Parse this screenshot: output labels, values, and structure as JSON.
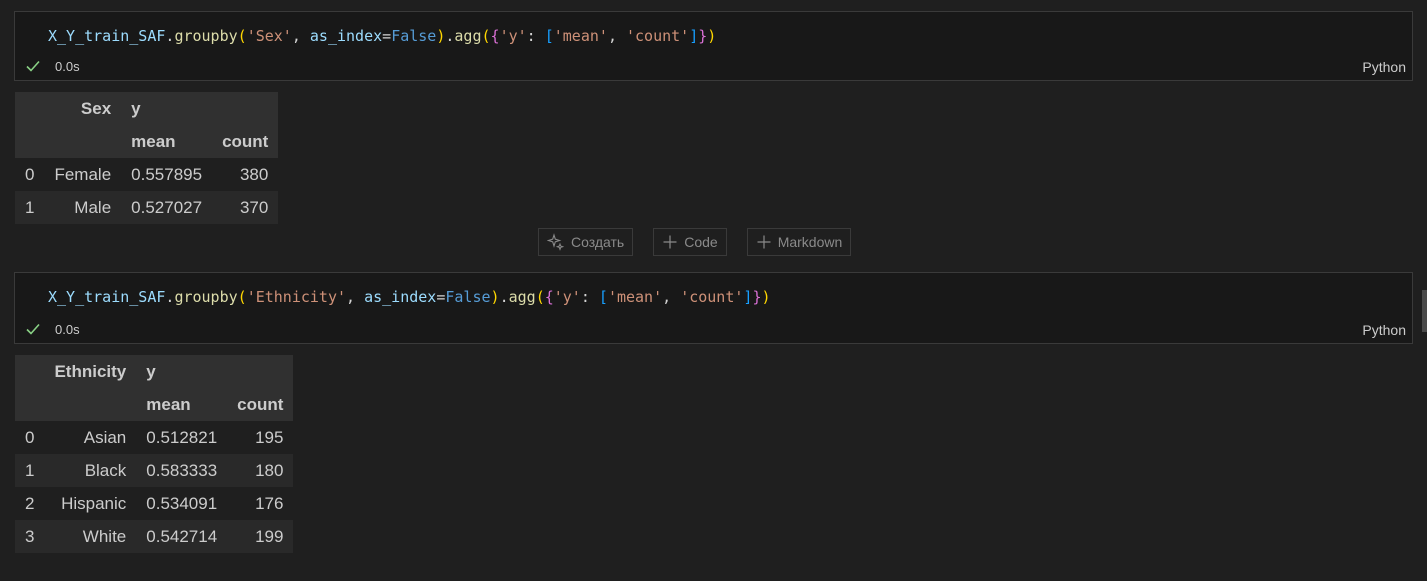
{
  "cells": [
    {
      "code_tokens": [
        {
          "t": "X_Y_train_SAF",
          "c": "var"
        },
        {
          "t": ".",
          "c": "p"
        },
        {
          "t": "groupby",
          "c": "fn"
        },
        {
          "t": "(",
          "c": "br1"
        },
        {
          "t": "'Sex'",
          "c": "str"
        },
        {
          "t": ", ",
          "c": "p"
        },
        {
          "t": "as_index",
          "c": "var"
        },
        {
          "t": "=",
          "c": "p"
        },
        {
          "t": "False",
          "c": "kw"
        },
        {
          "t": ")",
          "c": "br1"
        },
        {
          "t": ".",
          "c": "p"
        },
        {
          "t": "agg",
          "c": "fn"
        },
        {
          "t": "(",
          "c": "br1"
        },
        {
          "t": "{",
          "c": "br2"
        },
        {
          "t": "'y'",
          "c": "str"
        },
        {
          "t": ": ",
          "c": "p"
        },
        {
          "t": "[",
          "c": "br3"
        },
        {
          "t": "'mean'",
          "c": "str"
        },
        {
          "t": ", ",
          "c": "p"
        },
        {
          "t": "'count'",
          "c": "str"
        },
        {
          "t": "]",
          "c": "br3"
        },
        {
          "t": "}",
          "c": "br2"
        },
        {
          "t": ")",
          "c": "br1"
        }
      ],
      "exec_time": "0.0s",
      "language": "Python",
      "output": {
        "header_row1": [
          "",
          "Sex",
          "y",
          ""
        ],
        "header_row2": [
          "",
          "",
          "mean",
          "count"
        ],
        "rows": [
          [
            "0",
            "Female",
            "0.557895",
            "380"
          ],
          [
            "1",
            "Male",
            "0.527027",
            "370"
          ]
        ]
      }
    },
    {
      "code_tokens": [
        {
          "t": "X_Y_train_SAF",
          "c": "var"
        },
        {
          "t": ".",
          "c": "p"
        },
        {
          "t": "groupby",
          "c": "fn"
        },
        {
          "t": "(",
          "c": "br1"
        },
        {
          "t": "'Ethnicity'",
          "c": "str"
        },
        {
          "t": ", ",
          "c": "p"
        },
        {
          "t": "as_index",
          "c": "var"
        },
        {
          "t": "=",
          "c": "p"
        },
        {
          "t": "False",
          "c": "kw"
        },
        {
          "t": ")",
          "c": "br1"
        },
        {
          "t": ".",
          "c": "p"
        },
        {
          "t": "agg",
          "c": "fn"
        },
        {
          "t": "(",
          "c": "br1"
        },
        {
          "t": "{",
          "c": "br2"
        },
        {
          "t": "'y'",
          "c": "str"
        },
        {
          "t": ": ",
          "c": "p"
        },
        {
          "t": "[",
          "c": "br3"
        },
        {
          "t": "'mean'",
          "c": "str"
        },
        {
          "t": ", ",
          "c": "p"
        },
        {
          "t": "'count'",
          "c": "str"
        },
        {
          "t": "]",
          "c": "br3"
        },
        {
          "t": "}",
          "c": "br2"
        },
        {
          "t": ")",
          "c": "br1"
        }
      ],
      "exec_time": "0.0s",
      "language": "Python",
      "output": {
        "header_row1": [
          "",
          "Ethnicity",
          "y",
          ""
        ],
        "header_row2": [
          "",
          "",
          "mean",
          "count"
        ],
        "rows": [
          [
            "0",
            "Asian",
            "0.512821",
            "195"
          ],
          [
            "1",
            "Black",
            "0.583333",
            "180"
          ],
          [
            "2",
            "Hispanic",
            "0.534091",
            "176"
          ],
          [
            "3",
            "White",
            "0.542714",
            "199"
          ]
        ]
      }
    }
  ],
  "add_bar": {
    "generate_label": "Создать",
    "code_label": "Code",
    "markdown_label": "Markdown"
  },
  "icons": {
    "status": "check-icon",
    "generate": "sparkle-icon",
    "add": "plus-icon"
  },
  "colors": {
    "success": "#89d185",
    "background": "#1f1f1f"
  }
}
